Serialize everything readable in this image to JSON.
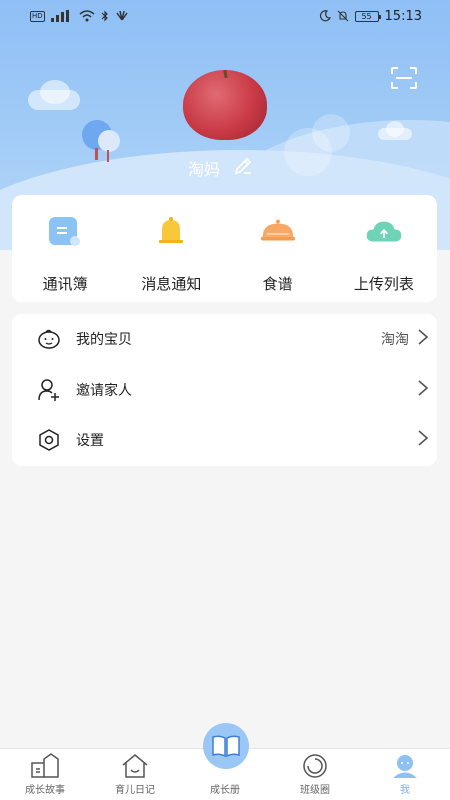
{
  "status_bar": {
    "time": "15:13",
    "battery": "55",
    "hd": "HD"
  },
  "profile": {
    "name": "淘妈"
  },
  "quick_actions": [
    {
      "label": "通讯簿",
      "icon": "contacts-icon"
    },
    {
      "label": "消息通知",
      "icon": "bell-icon"
    },
    {
      "label": "食谱",
      "icon": "recipe-dish-icon"
    },
    {
      "label": "上传列表",
      "icon": "cloud-upload-icon"
    }
  ],
  "menu": [
    {
      "label": "我的宝贝",
      "value": "淘淘",
      "icon": "baby-face-icon"
    },
    {
      "label": "邀请家人",
      "value": "",
      "icon": "add-user-icon"
    },
    {
      "label": "设置",
      "value": "",
      "icon": "settings-hex-icon"
    }
  ],
  "tabs": [
    {
      "label": "成长故事",
      "icon": "growth-story-icon"
    },
    {
      "label": "育儿日记",
      "icon": "diary-house-icon"
    },
    {
      "label": "成长册",
      "icon": "book-icon"
    },
    {
      "label": "班级圈",
      "icon": "class-circle-icon"
    },
    {
      "label": "我",
      "icon": "me-icon"
    }
  ],
  "colors": {
    "accent": "#7ab3f2",
    "banner_top": "#8fbff5",
    "background": "#f5f5f5"
  }
}
